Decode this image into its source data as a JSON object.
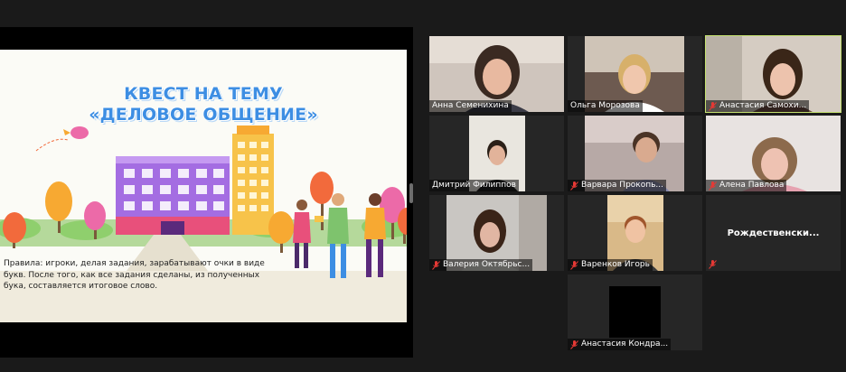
{
  "slide": {
    "title_line1": "КВЕСТ НА ТЕМУ",
    "title_line2": "«ДЕЛОВОЕ ОБЩЕНИЕ»",
    "rules": "Правила: игроки, делая задания, зарабатывают очки в виде букв. После того, как все задания сделаны, из полученных бука, составляется итоговое слово."
  },
  "participants": [
    {
      "name": "Анна Семенихина",
      "muted": false
    },
    {
      "name": "Ольга Морозова",
      "muted": false
    },
    {
      "name": "Анастасия Самохи...",
      "muted": true,
      "active_speaker": true
    },
    {
      "name": "Дмитрий Филиппов",
      "muted": false
    },
    {
      "name": "Варвара Прокопь...",
      "muted": true
    },
    {
      "name": "Алена Павлова",
      "muted": true
    },
    {
      "name": "Валерия Октябрьс...",
      "muted": true
    },
    {
      "name": "Варенков Игорь",
      "muted": true
    },
    {
      "name": "Рождественски...",
      "muted": true,
      "video_off": true
    },
    {
      "name": "Анастасия Кондра...",
      "muted": true
    }
  ],
  "colors": {
    "active_speaker_border": "#c4e06e",
    "mic_muted": "#e53935",
    "title_blue": "#3d8ee3"
  }
}
